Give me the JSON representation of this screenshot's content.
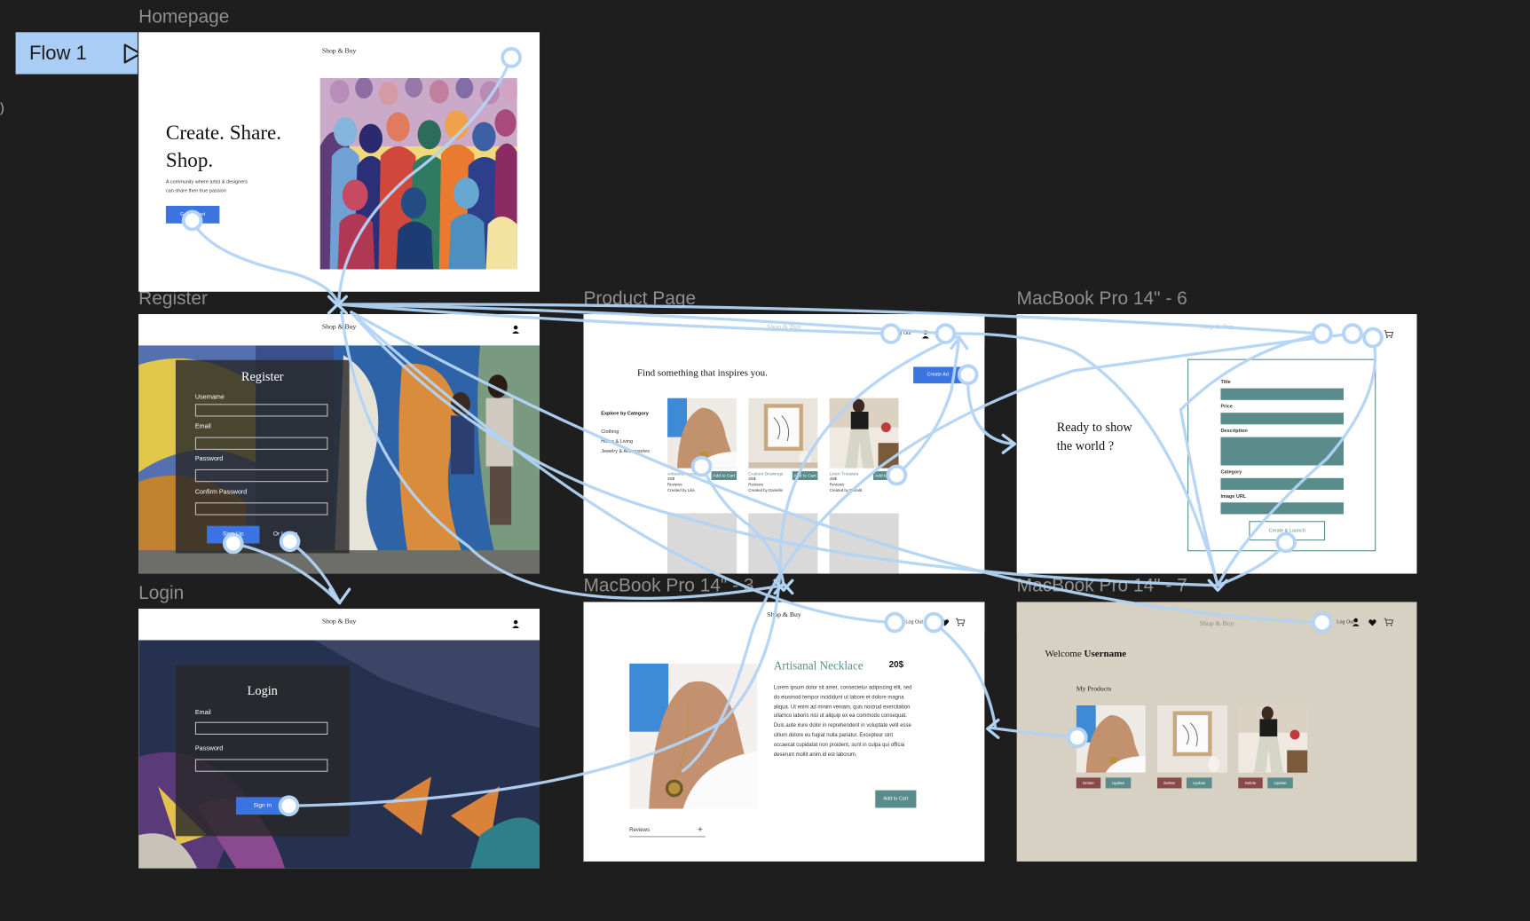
{
  "flow_button": {
    "label": "Flow 1"
  },
  "side_marker": ")",
  "frames": {
    "homepage": {
      "label": "Homepage"
    },
    "register": {
      "label": "Register"
    },
    "login": {
      "label": "Login"
    },
    "product_page": {
      "label": "Product Page"
    },
    "mbp6": {
      "label": "MacBook Pro 14\" - 6"
    },
    "mbp3": {
      "label": "MacBook Pro 14\" - 3"
    },
    "mbp7": {
      "label": "MacBook Pro 14\" - 7"
    }
  },
  "homepage": {
    "brand": "Shop & Buy",
    "headline_1": "Create. Share.",
    "headline_2": "Shop.",
    "sub_1": "A community where artist & designers",
    "sub_2": "can share their true passion",
    "cta": "Get Started"
  },
  "register": {
    "brand": "Shop & Buy",
    "title": "Register",
    "username_label": "Username",
    "email_label": "Email",
    "password_label": "Password",
    "confirm_label": "Confirm Password",
    "signup": "Sign Up",
    "or_login": "Or Log In"
  },
  "login": {
    "brand": "Shop & Buy",
    "title": "Login",
    "email_label": "Email",
    "password_label": "Password",
    "signin": "Sign In"
  },
  "product_page": {
    "brand": "Shop & Buy",
    "logout": "Log Out",
    "heading": "Find something that inspires you.",
    "create": "Create Ad",
    "explore": "Explore by Category",
    "categories": [
      "Clothing",
      "Home & Living",
      "Jewelry & Accessories"
    ],
    "products": [
      {
        "name": "Artisanal Necklace",
        "price": "20$",
        "reviews": "Reviews",
        "creator": "Created by Lilia",
        "add": "Add to Cart"
      },
      {
        "name": "Custom Drawings",
        "price": "25$",
        "reviews": "Reviews",
        "creator": "Created by Danielle",
        "add": "Add to Cart"
      },
      {
        "name": "Linen Trousers",
        "price": "45$",
        "reviews": "Reviews",
        "creator": "Created by Ronald",
        "add": "Add to Cart"
      }
    ]
  },
  "mbp6": {
    "brand": "Shop & Buy",
    "heading_1": "Ready to show",
    "heading_2": "the world ?",
    "title_label": "Title",
    "price_label": "Price",
    "description_label": "Description",
    "category_label": "Category",
    "image_label": "Image URL",
    "submit": "Create & Launch"
  },
  "mbp3": {
    "brand": "Shop & Buy",
    "logout": "Log Out",
    "product_name": "Artisanal Necklace",
    "price": "20$",
    "description": "Lorem ipsum dolor sit amet, consectetur adipiscing elit, sed do eiusmod tempor incididunt ut labore et dolore magna aliqua. Ut enim ad minim veniam, quis nostrud exercitation ullamco laboris nisi ut aliquip ex ea commodo consequat. Duis aute irure dolor in reprehenderit in voluptate velit esse cillum dolore eu fugiat nulla pariatur. Excepteur sint occaecat cupidatat non proident, sunt in culpa qui officia deserunt mollit anim id est laborum.",
    "add": "Add to Cart",
    "reviews": "Reviews",
    "plus": "+"
  },
  "mbp7": {
    "brand": "Shop & Buy",
    "logout": "Log Out",
    "welcome": "Welcome",
    "username": "Username",
    "my_products": "My Products",
    "delete": "Delete",
    "update": "Update"
  },
  "colors": {
    "canvas": "#1e1e1e",
    "flow_line": "#b3d4f5",
    "primary_button": "#3b74e0",
    "teal": "#5b8c8c",
    "delete": "#8b4a4a",
    "beige": "#d6d1c2"
  }
}
